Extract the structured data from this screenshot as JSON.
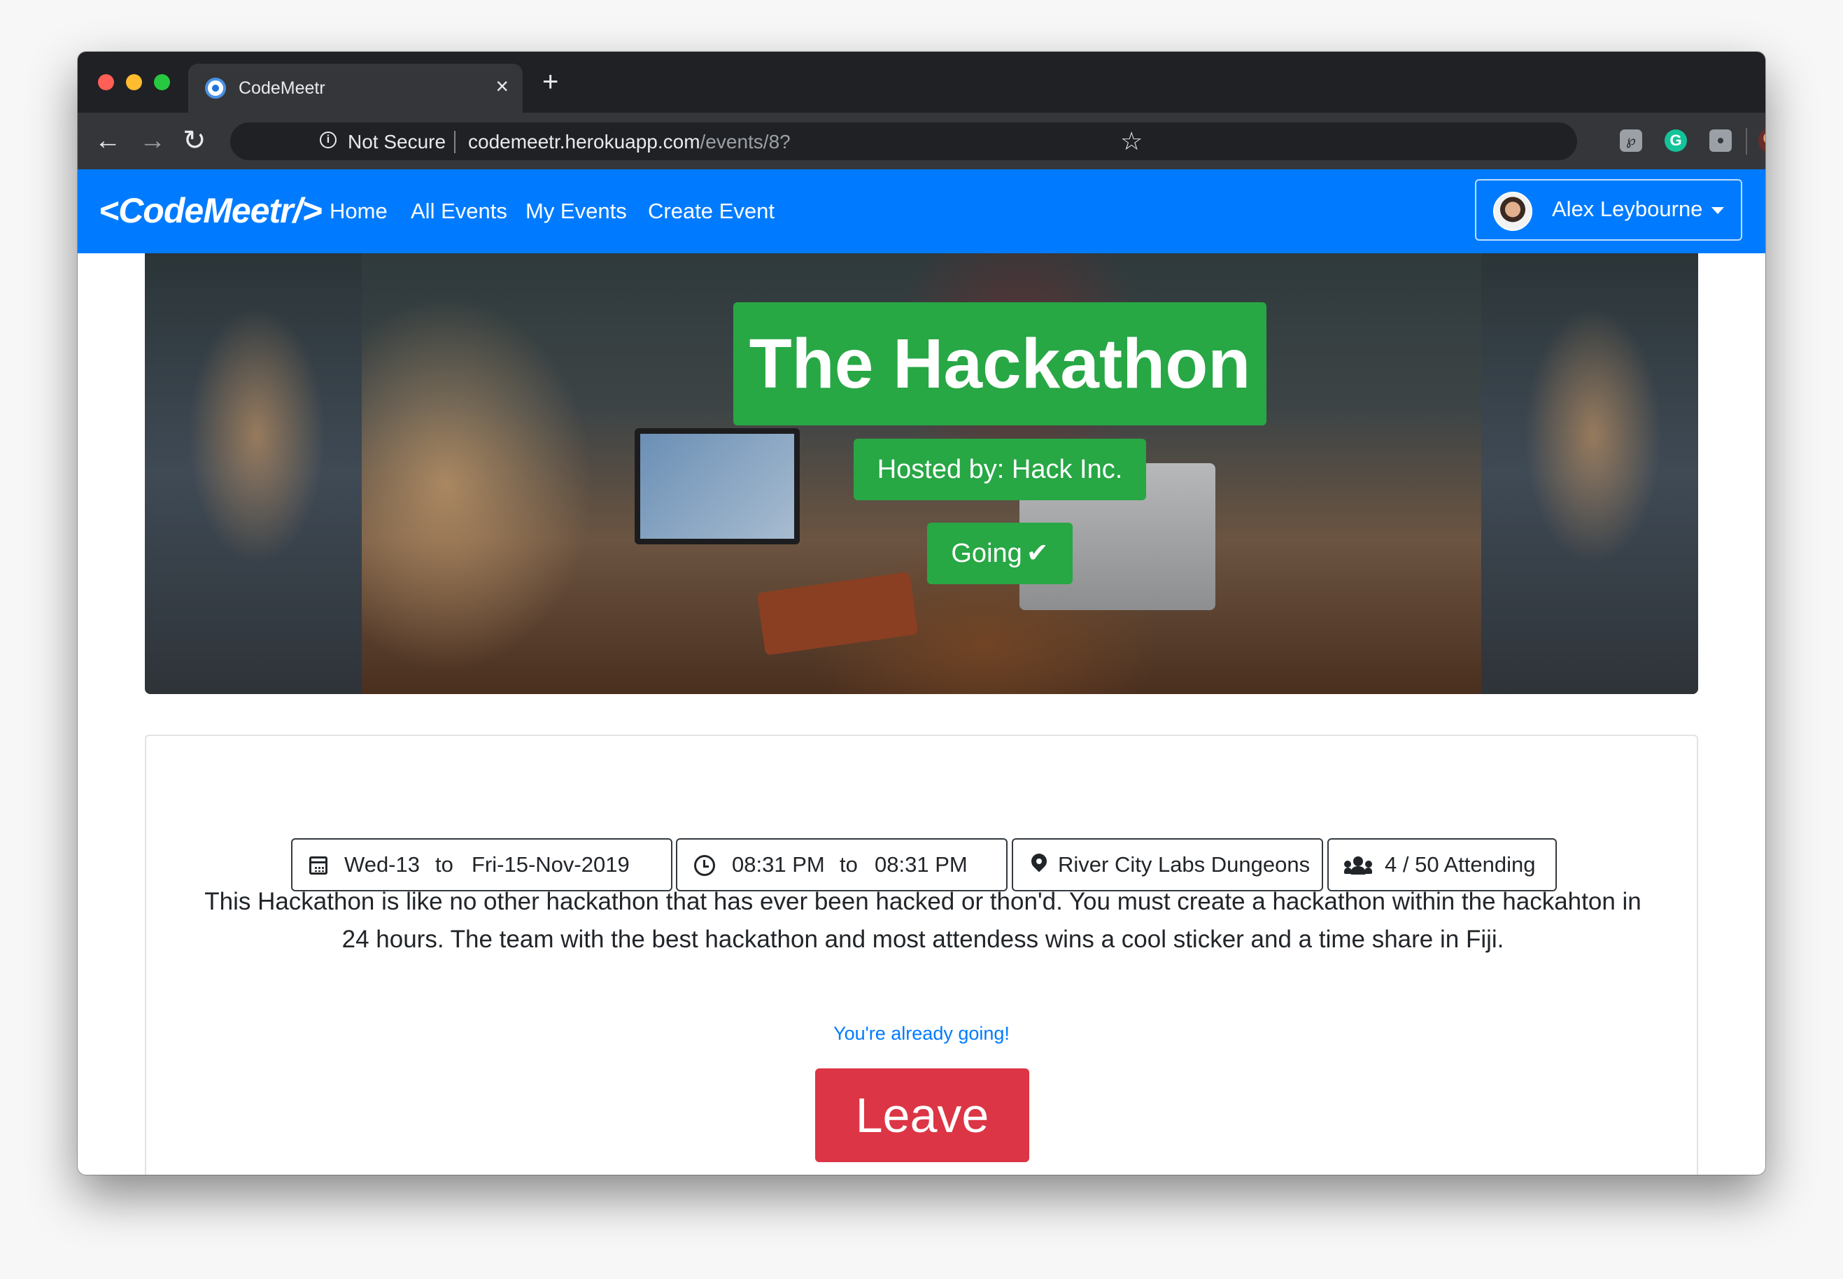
{
  "browser": {
    "tab_title": "CodeMeetr",
    "tab_close": "×",
    "new_tab": "+",
    "security_label": "Not Secure",
    "url_host": "codemeetr.herokuapp.com",
    "url_path": "/events/8?",
    "back_icon": "arrow-left-icon",
    "forward_icon": "arrow-right-icon",
    "reload_icon": "reload-icon",
    "star_icon": "star-icon"
  },
  "navbar": {
    "brand": "<CodeMeetr/>",
    "links": [
      "Home",
      "All Events",
      "My Events",
      "Create Event"
    ],
    "user_name": "Alex Leybourne",
    "bg_color": "#007bff"
  },
  "event": {
    "title": "The Hackathon",
    "host": "Hosted by: Hack Inc.",
    "status": "Going",
    "status_check": "✔",
    "date_from": "Wed-13",
    "date_to": "Fri-15-Nov-2019",
    "time_from": "08:31 PM",
    "time_to": "08:31 PM",
    "range_word": "to",
    "location": "River City Labs Dungeons",
    "attending": "4 / 50 Attending",
    "description": "This Hackathon is like no other hackathon that has ever been hacked or thon'd. You must create a hackathon within the hackahton in 24 hours. The team with the best hackathon and most attendess wins a cool sticker and a time share in Fiji.",
    "already_going": "You're already going!",
    "leave_label": "Leave",
    "badge_color": "#28a745",
    "leave_color": "#dc3545"
  }
}
